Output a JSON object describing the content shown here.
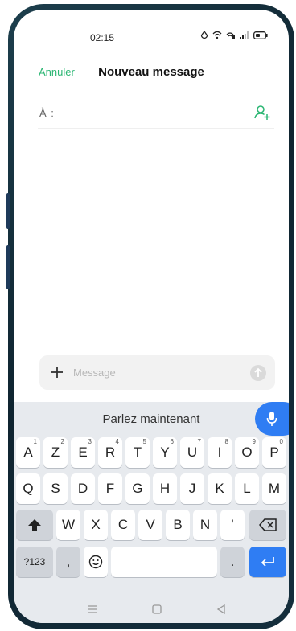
{
  "status_bar": {
    "time": "02:15"
  },
  "header": {
    "cancel_label": "Annuler",
    "title": "Nouveau message"
  },
  "recipient": {
    "label": "À :"
  },
  "composer": {
    "placeholder": "Message"
  },
  "keyboard": {
    "voice_prompt": "Parlez maintenant",
    "row1": [
      {
        "key": "A",
        "hint": "1"
      },
      {
        "key": "Z",
        "hint": "2"
      },
      {
        "key": "E",
        "hint": "3"
      },
      {
        "key": "R",
        "hint": "4"
      },
      {
        "key": "T",
        "hint": "5"
      },
      {
        "key": "Y",
        "hint": "6"
      },
      {
        "key": "U",
        "hint": "7"
      },
      {
        "key": "I",
        "hint": "8"
      },
      {
        "key": "O",
        "hint": "9"
      },
      {
        "key": "P",
        "hint": "0"
      }
    ],
    "row2": [
      "Q",
      "S",
      "D",
      "F",
      "G",
      "H",
      "J",
      "K",
      "L",
      "M"
    ],
    "row3": [
      "W",
      "X",
      "C",
      "V",
      "B",
      "N",
      "'"
    ],
    "symbols_label": "?123",
    "comma_label": ",",
    "period_label": "."
  },
  "colors": {
    "accent_green": "#2bb673",
    "accent_blue": "#2f7df3"
  }
}
